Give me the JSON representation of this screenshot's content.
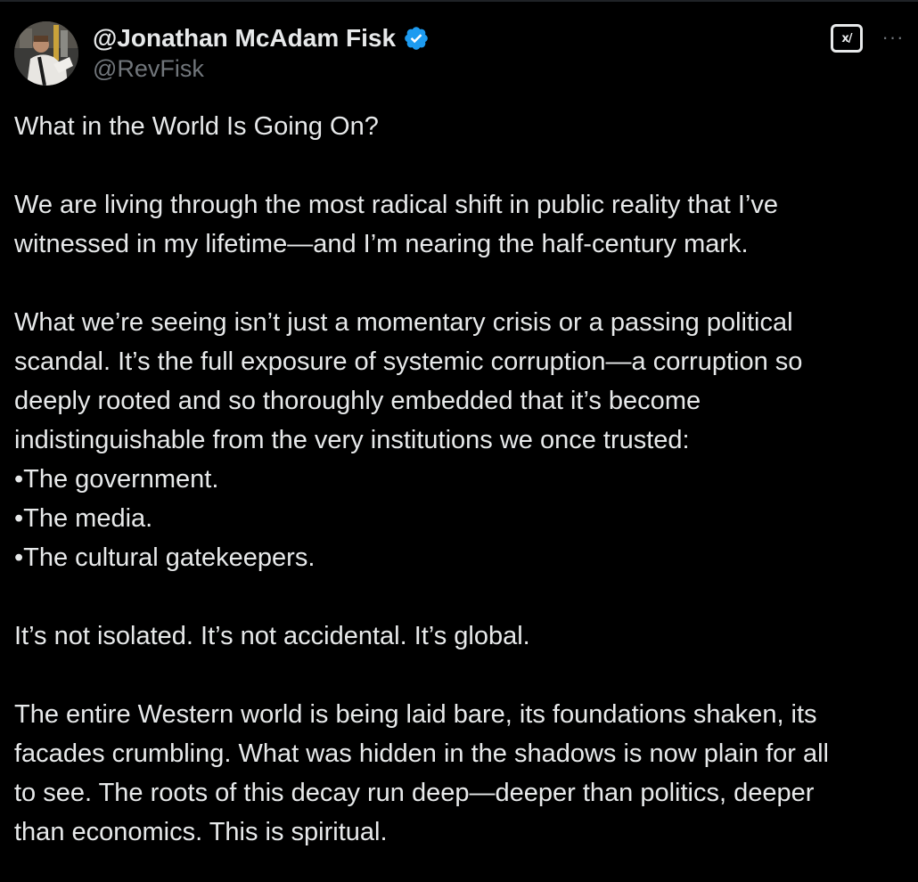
{
  "tweet": {
    "display_name": "@Jonathan McAdam Fisk",
    "handle": "@RevFisk",
    "verified_icon": "verified-badge-icon",
    "grok_label": "x/",
    "more_label": "···",
    "lines": [
      "What in the World Is Going On?",
      "",
      "We are living through the most radical shift in public reality that I’ve",
      "witnessed in my lifetime—and I’m nearing the half-century mark.",
      "",
      "What we’re seeing isn’t just a momentary crisis or a passing political",
      "scandal. It’s the full exposure of systemic corruption—a corruption so",
      "deeply rooted and so thoroughly embedded that it’s become",
      "indistinguishable from the very institutions we once trusted:",
      "•The government.",
      "•The media.",
      "•The cultural gatekeepers.",
      "",
      "It’s not isolated. It’s not accidental. It’s global.",
      "",
      "The entire Western world is being laid bare, its foundations shaken, its",
      "facades crumbling. What was hidden in the shadows is now plain for all",
      "to see. The roots of this decay run deep—deeper than politics, deeper",
      "than economics. This is spiritual."
    ]
  },
  "colors": {
    "background": "#000000",
    "text": "#e7e9ea",
    "secondary": "#71767b",
    "verified": "#1d9bf0"
  }
}
